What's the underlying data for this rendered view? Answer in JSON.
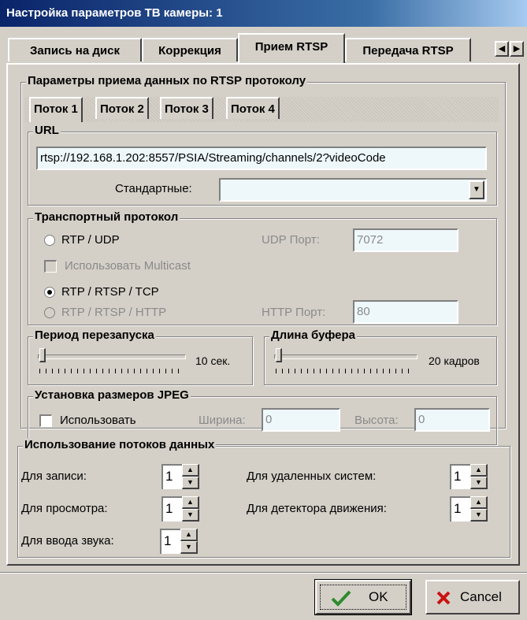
{
  "window": {
    "title": "Настройка параметров ТВ камеры: 1"
  },
  "tabs": [
    {
      "label": "Запись на диск",
      "active": false
    },
    {
      "label": "Коррекция",
      "active": false
    },
    {
      "label": "Прием RTSP",
      "active": true
    },
    {
      "label": "Передача RTSP",
      "active": false
    }
  ],
  "tab_scroll": {
    "left_icon": "arrow-left-icon",
    "right_icon": "arrow-right-icon"
  },
  "rtsp_group": {
    "title": "Параметры приема данных по RTSP протоколу",
    "streams": [
      "Поток 1",
      "Поток 2",
      "Поток 3",
      "Поток 4"
    ],
    "active_stream": 0
  },
  "url": {
    "title": "URL",
    "value": "rtsp://192.168.1.202:8557/PSIA/Streaming/channels/2?videoCode",
    "standard_label": "Стандартные:",
    "standard_value": ""
  },
  "transport": {
    "title": "Транспортный протокол",
    "rtp_udp": "RTP / UDP",
    "udp_port_label": "UDP Порт:",
    "udp_port": "7072",
    "multicast": "Использовать Multicast",
    "rtp_rtsp_tcp": "RTP / RTSP / TCP",
    "rtp_rtsp_http": "RTP / RTSP / HTTP",
    "http_port_label": "HTTP Порт:",
    "http_port": "80",
    "selected": "RTP / RTSP / TCP"
  },
  "restart": {
    "title": "Период перезапуска",
    "value_text": "10 сек.",
    "level": 0.05
  },
  "buffer": {
    "title": "Длина буфера",
    "value_text": "20 кадров",
    "level": 0.05
  },
  "jpeg": {
    "title": "Установка размеров JPEG",
    "use_label": "Использовать",
    "width_label": "Ширина:",
    "width": "0",
    "height_label": "Высота:",
    "height": "0"
  },
  "streams_usage": {
    "title": "Использование потоков данных",
    "record_label": "Для записи:",
    "record": "1",
    "view_label": "Для просмотра:",
    "view": "1",
    "audio_label": "Для ввода звука:",
    "audio": "1",
    "remote_label": "Для удаленных систем:",
    "remote": "1",
    "motion_label": "Для детектора движения:",
    "motion": "1"
  },
  "buttons": {
    "ok": "OK",
    "cancel": "Cancel"
  },
  "colors": {
    "title_bar": "#0a246a",
    "face": "#d4d0c8",
    "ok_icon": "#2e8b2e",
    "cancel_icon": "#cc1111"
  }
}
